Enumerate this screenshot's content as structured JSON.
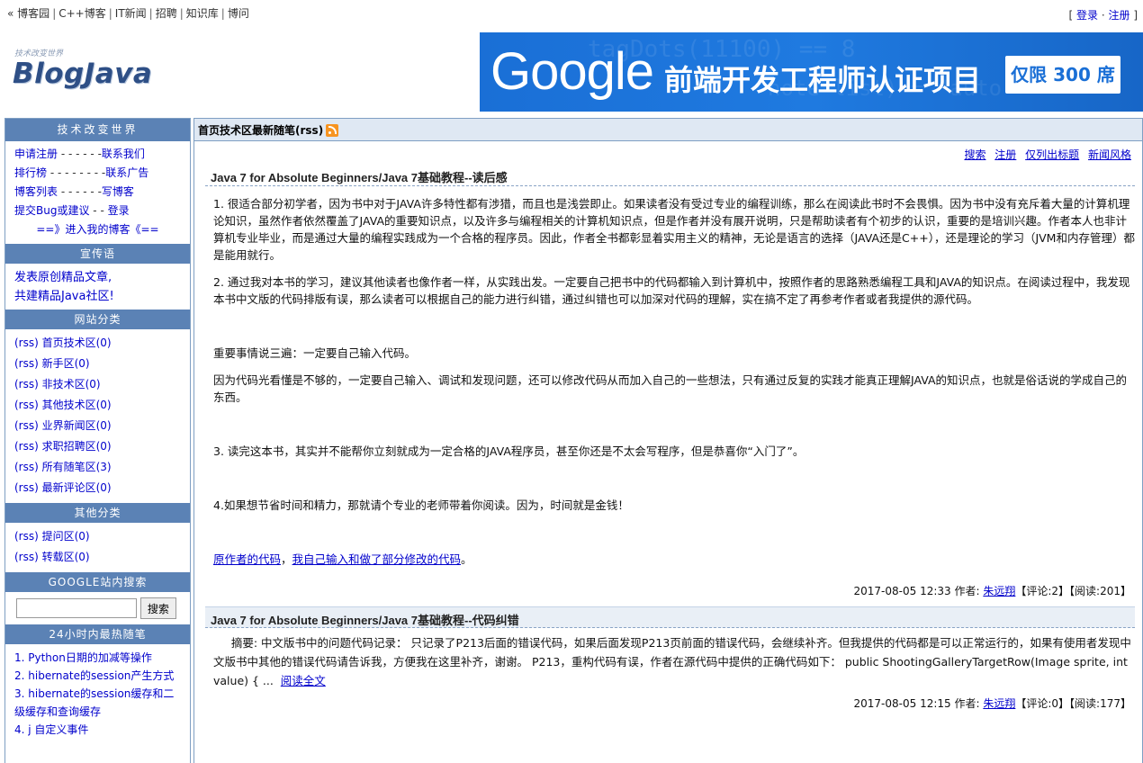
{
  "topnav": {
    "prefix": "«",
    "items": [
      "博客园",
      "C++博客",
      "IT新闻",
      "招聘",
      "知识库",
      "博问"
    ]
  },
  "login": {
    "open": "[",
    "login": "登录",
    "dot": "·",
    "register": "注册",
    "close": "]"
  },
  "header": {
    "slogan": "技术改变世界",
    "logo": "BlogJava",
    "banner": {
      "brand": "Google",
      "headline": "前端开发工程师认证项目",
      "badge": "仅限 300 席",
      "bg_code_1": "tagDots(11100) == 8",
      "bg_code_2": "note-list) = \"auto\""
    }
  },
  "sidebar": {
    "title": "技术改变世界",
    "links": [
      {
        "left": "申请注册",
        "dashes": "- - - - - -",
        "right": "联系我们"
      },
      {
        "left": "排行榜",
        "dashes": "- - - - - - - -",
        "right": "联系广告"
      },
      {
        "left": "博客列表",
        "dashes": "- - - - - -",
        "right": "写博客"
      },
      {
        "left": "提交Bug或建议",
        "dashes": "- -",
        "right": "登录"
      }
    ],
    "enter": "==》进入我的博客《==",
    "promo_head": "宣传语",
    "promo_lines": [
      "发表原创精品文章,",
      "共建精品Java社区!"
    ],
    "site_cat_head": "网站分类",
    "site_categories": [
      "(rss) 首页技术区(0)",
      "(rss) 新手区(0)",
      "(rss) 非技术区(0)",
      "(rss) 其他技术区(0)",
      "(rss) 业界新闻区(0)",
      "(rss) 求职招聘区(0)",
      "(rss) 所有随笔区(3)",
      "(rss) 最新评论区(0)"
    ],
    "other_cat_head": "其他分类",
    "other_categories": [
      "(rss) 提问区(0)",
      "(rss) 转载区(0)"
    ],
    "search_head": "GOOGLE站内搜索",
    "search_value": "",
    "search_button": "搜索",
    "hot_head": "24小时内最热随笔",
    "hot_items": [
      "1. Python日期的加减等操作",
      "2. hibernate的session产生方式",
      "3. hibernate的session缓存和二级缓存和查询缓存",
      "4. j 自定义事件"
    ]
  },
  "main": {
    "heading": "首页技术区最新随笔(rss)",
    "links": [
      "搜索",
      "注册",
      "仅列出标题",
      "新闻风格"
    ],
    "post1": {
      "title": "Java 7 for Absolute Beginners/Java 7基础教程--读后感",
      "paragraphs": [
        "1. 很适合部分初学者，因为书中对于JAVA许多特性都有涉猎，而且也是浅尝即止。如果读者没有受过专业的编程训练，那么在阅读此书时不会畏惧。因为书中没有充斥着大量的计算机理论知识，虽然作者依然覆盖了JAVA的重要知识点，以及许多与编程相关的计算机知识点，但是作者并没有展开说明，只是帮助读者有个初步的认识，重要的是培训兴趣。作者本人也非计算机专业毕业，而是通过大量的编程实践成为一个合格的程序员。因此，作者全书都彰显着实用主义的精神，无论是语言的选择（JAVA还是C++），还是理论的学习（JVM和内存管理）都是能用就行。",
        "2. 通过我对本书的学习，建议其他读者也像作者一样，从实践出发。一定要自己把书中的代码都输入到计算机中，按照作者的思路熟悉编程工具和JAVA的知识点。在阅读过程中，我发现本书中文版的代码排版有误，那么读者可以根据自己的能力进行纠错，通过纠错也可以加深对代码的理解，实在搞不定了再参考作者或者我提供的源代码。",
        "重要事情说三遍：一定要自己输入代码。",
        "因为代码光看懂是不够的，一定要自己输入、调试和发现问题，还可以修改代码从而加入自己的一些想法，只有通过反复的实践才能真正理解JAVA的知识点，也就是俗话说的学成自己的东西。",
        "3. 读完这本书，其实并不能帮你立刻就成为一定合格的JAVA程序员，甚至你还是不太会写程序，但是恭喜你“入门了”。",
        "4.如果想节省时间和精力，那就请个专业的老师带着你阅读。因为，时间就是金钱！"
      ],
      "link1": "原作者的代码",
      "comma": "，",
      "link2": "我自己输入和做了部分修改的代码",
      "period": "。",
      "footer_time": "2017-08-05 12:33 作者:",
      "author": "朱远翔",
      "comments": "【评论:2】【阅读:201】"
    },
    "post2": {
      "title": "Java 7 for Absolute Beginners/Java 7基础教程--代码纠错",
      "excerpt": "摘要: 中文版书中的问题代码记录： 只记录了P213后面的错误代码，如果后面发现P213页前面的错误代码，会继续补齐。但我提供的代码都是可以正常运行的，如果有使用者发现中文版书中其他的错误代码请告诉我，方便我在这里补齐，谢谢。 P213，重构代码有误，作者在源代码中提供的正确代码如下： public ShootingGalleryTargetRow(Image sprite, int value) { ...",
      "read_more": "阅读全文",
      "footer_time": "2017-08-05 12:15 作者:",
      "author": "朱远翔",
      "comments": "【评论:0】【阅读:177】"
    }
  },
  "colors": {
    "sidebar_head": "#5b82b5",
    "border": "#7f9fc3",
    "main_head_bg": "#dfe8f3",
    "link": "#0000cc",
    "banner": "#1a6fd6",
    "logo": "#2e4f86",
    "rss": "#f79421"
  }
}
